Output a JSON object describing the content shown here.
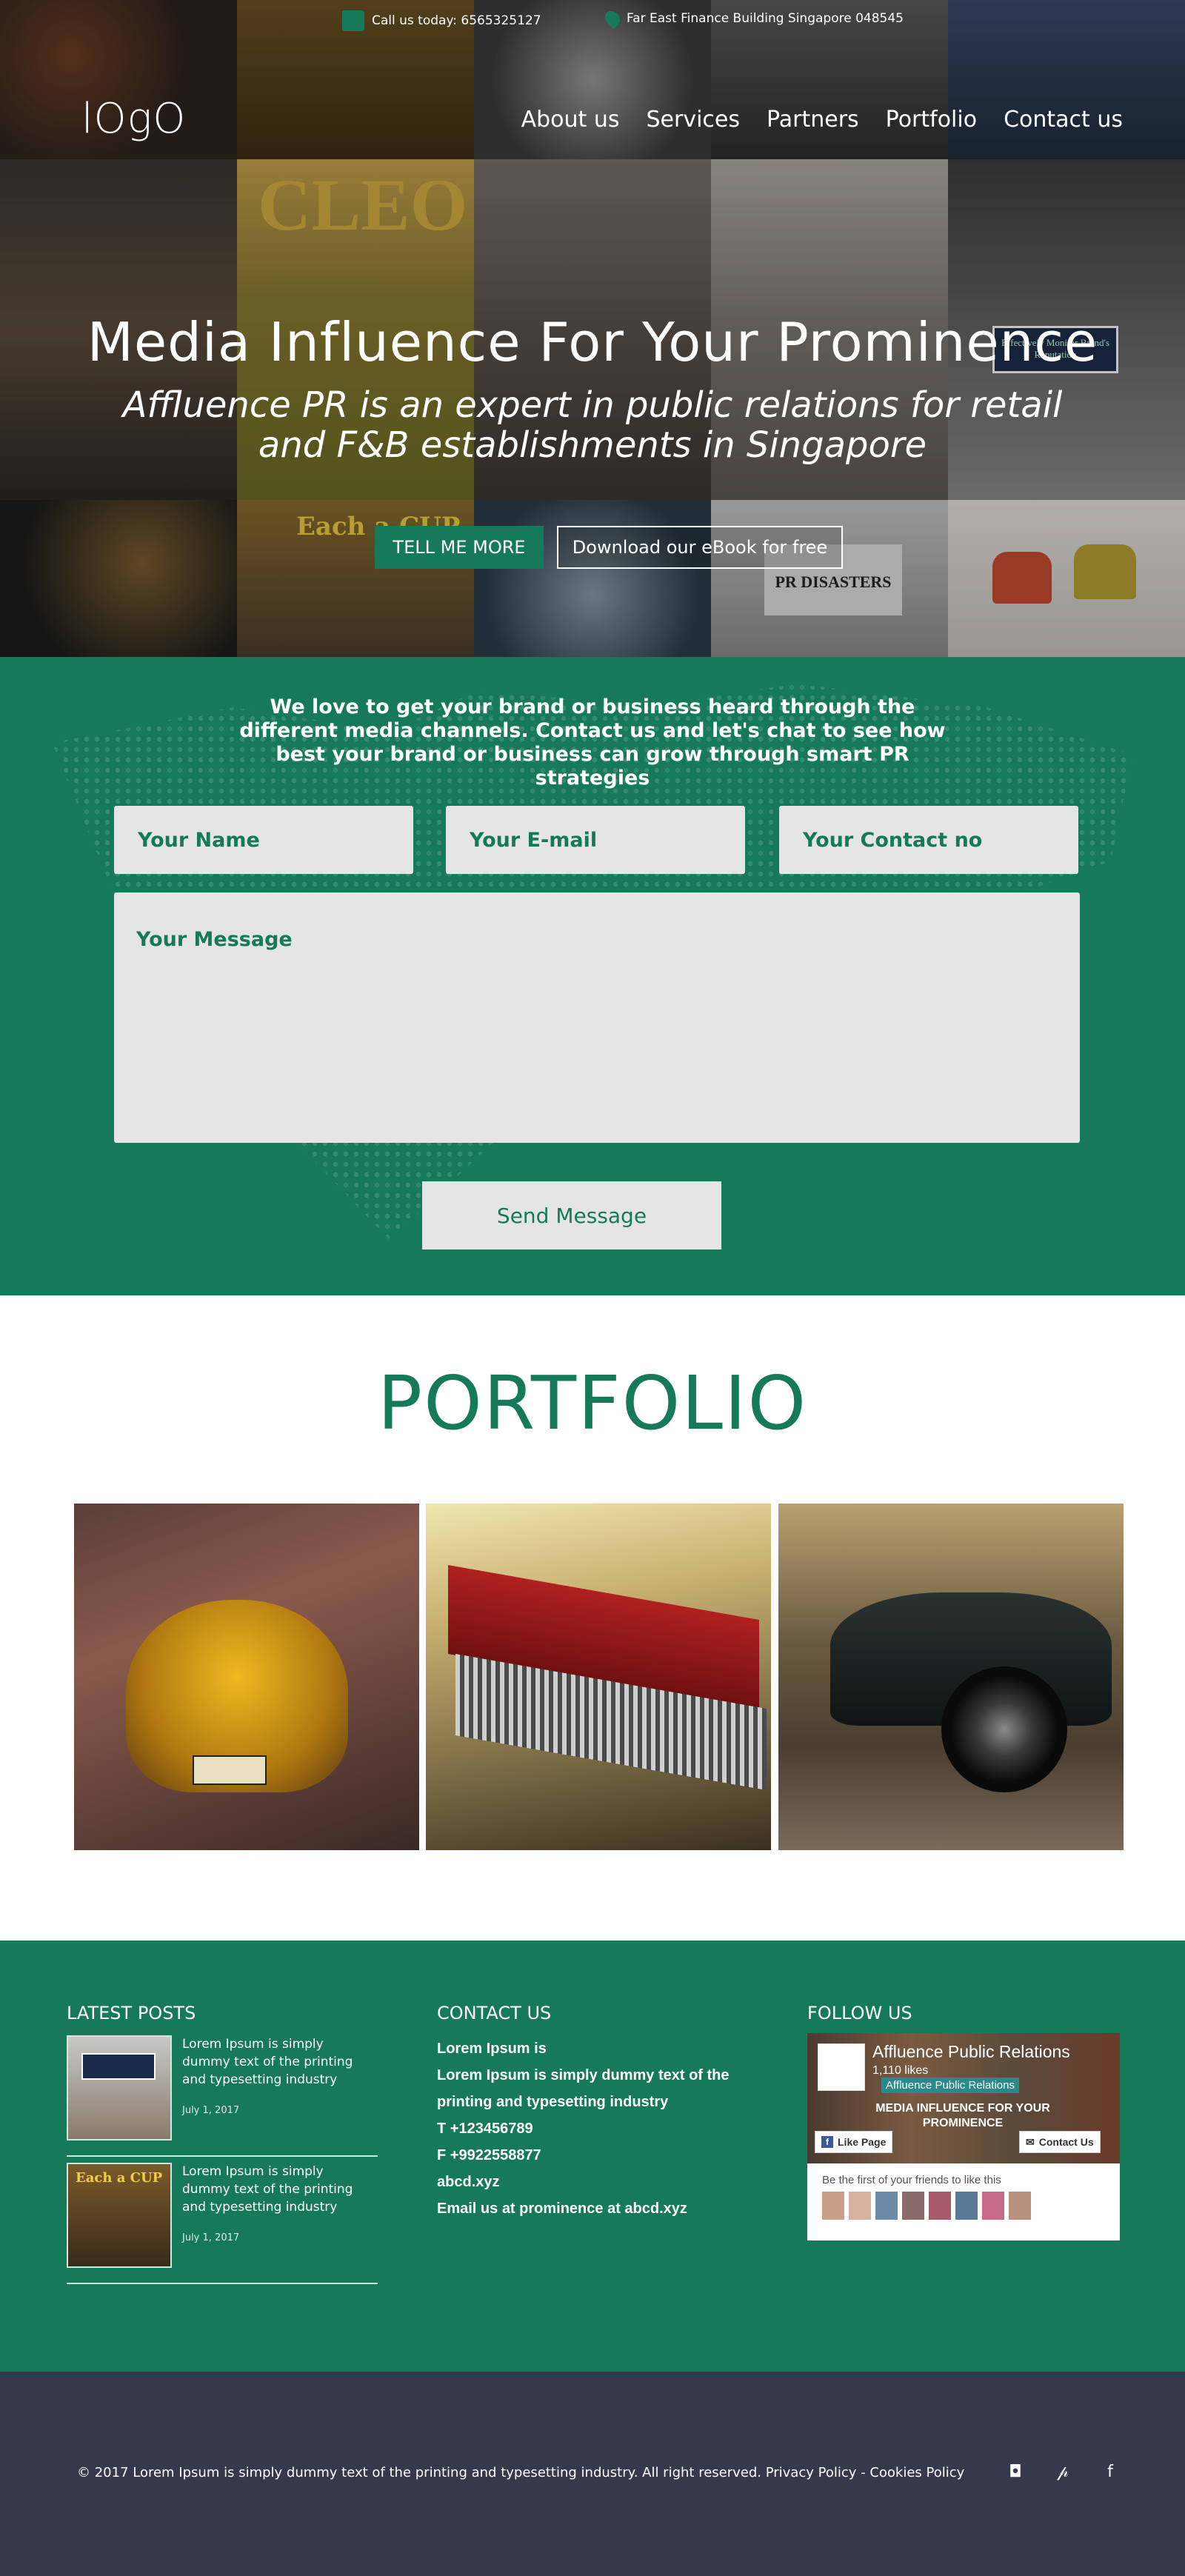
{
  "topbar": {
    "phone": "Call us today: 6565325127",
    "address": "Far East Finance Building Singapore 048545"
  },
  "header": {
    "logo": "lOgO",
    "nav": [
      "About us",
      "Services",
      "Partners",
      "Portfolio",
      "Contact us"
    ]
  },
  "hero": {
    "title": "Media Influence For Your Prominence",
    "subtitle": "Affluence PR is an expert in public relations for retail and F&B establishments in Singapore",
    "cta_primary": "TELL ME MORE",
    "cta_secondary": "Download our eBook for free",
    "bg_captions": {
      "magazine": "CLEO",
      "monitor": "Effectively Monitor Brand's Reputation",
      "disasters": "PR DISASTERS",
      "cafe": "Each a CUP"
    }
  },
  "contact_form": {
    "intro": "We love to get your brand or business heard through the different media channels. Contact us and let's chat to see how best your brand or business can grow through smart PR strategies",
    "name_placeholder": "Your Name",
    "email_placeholder": "Your E-mail",
    "phone_placeholder": "Your Contact no",
    "message_placeholder": "Your Message",
    "submit": "Send Message"
  },
  "portfolio": {
    "title": "PORTFOLIO",
    "items": [
      "yellow-beetle-car",
      "vintage-red-car-grille",
      "black-hot-rod"
    ]
  },
  "footer": {
    "latest_posts": {
      "heading": "LATEST POSTS",
      "posts": [
        {
          "text": "Lorem Ipsum is simply dummy text of the printing and typesetting industry",
          "date": "July 1, 2017"
        },
        {
          "text": "Lorem Ipsum is simply dummy text of the printing and typesetting industry",
          "date": "July 1, 2017"
        }
      ]
    },
    "contact": {
      "heading": "CONTACT US",
      "lines": [
        "Lorem Ipsum is",
        "Lorem Ipsum is simply dummy text of the",
        "printing and typesetting industry",
        "T +123456789",
        "F +9922558877",
        "abcd.xyz",
        "Email us at prominence at abcd.xyz"
      ]
    },
    "follow": {
      "heading": "FOLLOW US",
      "page_name": "Affluence Public Relations",
      "likes": "1,110 likes",
      "tag": "Affluence Public Relations",
      "banner": "MEDIA INFLUENCE FOR YOUR PROMINENCE",
      "like_btn": "Like Page",
      "contact_btn": "Contact Us",
      "friends_text": "Be the first of your friends to like this"
    }
  },
  "bottom": {
    "copyright": "© 2017 Lorem Ipsum is simply dummy text of the printing and typesetting industry. All right reserved. Privacy Policy - Cookies Policy",
    "social": [
      "instagram-icon",
      "pinterest-icon",
      "facebook-icon"
    ],
    "social_glyphs": [
      "◘",
      "𝓅",
      "f"
    ]
  },
  "colors": {
    "accent": "#167a5a",
    "field_bg": "#e5e5e5",
    "bottom_bar": "#343a4c"
  }
}
